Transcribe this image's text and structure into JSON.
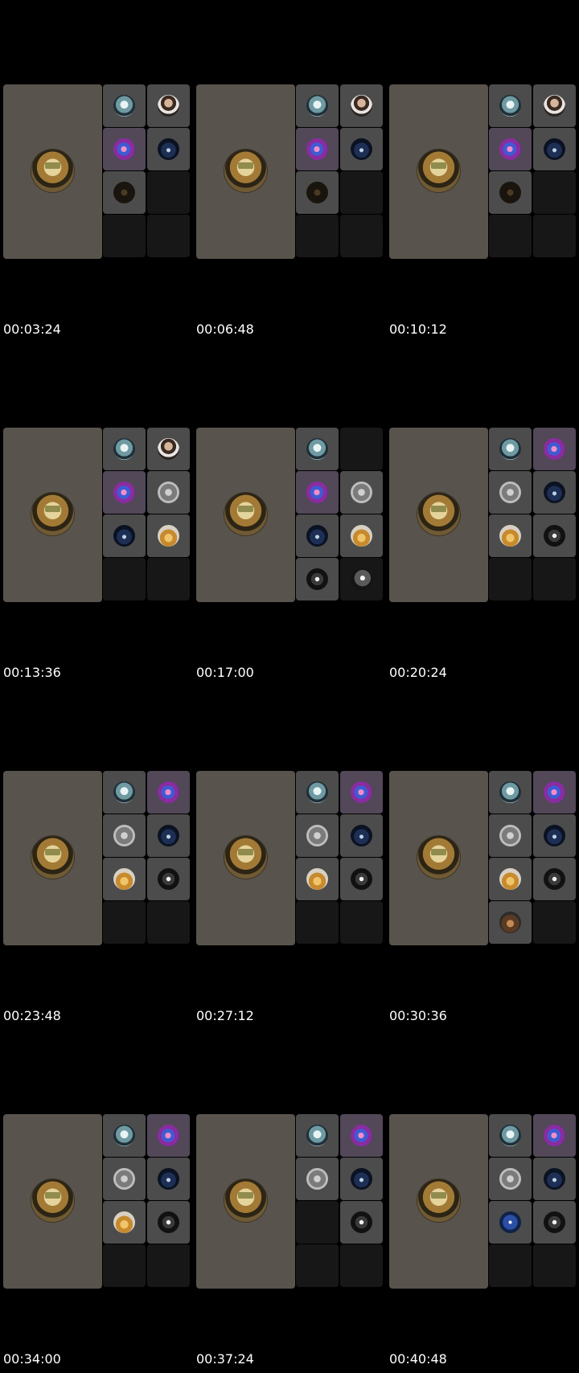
{
  "frames": [
    {
      "timestamp": "00:03:24",
      "cells": [
        {
          "kind": "white",
          "state": "on"
        },
        {
          "kind": "man",
          "state": "on"
        },
        {
          "kind": "anime",
          "state": "tint"
        },
        {
          "kind": "hood",
          "state": "on"
        },
        {
          "kind": "dark",
          "state": "on"
        },
        {
          "kind": "",
          "state": "off"
        },
        {
          "kind": "",
          "state": "off"
        },
        {
          "kind": "",
          "state": "off"
        }
      ]
    },
    {
      "timestamp": "00:06:48",
      "cells": [
        {
          "kind": "white",
          "state": "on"
        },
        {
          "kind": "man",
          "state": "on"
        },
        {
          "kind": "anime",
          "state": "tint"
        },
        {
          "kind": "hood",
          "state": "on"
        },
        {
          "kind": "dark",
          "state": "on"
        },
        {
          "kind": "",
          "state": "off"
        },
        {
          "kind": "",
          "state": "off"
        },
        {
          "kind": "",
          "state": "off"
        }
      ]
    },
    {
      "timestamp": "00:10:12",
      "cells": [
        {
          "kind": "white",
          "state": "on"
        },
        {
          "kind": "man",
          "state": "on"
        },
        {
          "kind": "anime",
          "state": "tint"
        },
        {
          "kind": "hood",
          "state": "on"
        },
        {
          "kind": "dark",
          "state": "on"
        },
        {
          "kind": "",
          "state": "off"
        },
        {
          "kind": "",
          "state": "off"
        },
        {
          "kind": "",
          "state": "off"
        }
      ]
    },
    {
      "timestamp": "00:13:36",
      "cells": [
        {
          "kind": "white",
          "state": "on"
        },
        {
          "kind": "man",
          "state": "on"
        },
        {
          "kind": "anime",
          "state": "tint"
        },
        {
          "kind": "statue",
          "state": "on"
        },
        {
          "kind": "hood",
          "state": "on"
        },
        {
          "kind": "gold",
          "state": "on"
        },
        {
          "kind": "",
          "state": "off"
        },
        {
          "kind": "",
          "state": "off"
        }
      ]
    },
    {
      "timestamp": "00:17:00",
      "cells": [
        {
          "kind": "white",
          "state": "on"
        },
        {
          "kind": "",
          "state": "off"
        },
        {
          "kind": "anime",
          "state": "tint"
        },
        {
          "kind": "statue",
          "state": "on"
        },
        {
          "kind": "hood",
          "state": "on"
        },
        {
          "kind": "gold",
          "state": "on"
        },
        {
          "kind": "skull",
          "state": "on"
        },
        {
          "kind": "bw",
          "state": "off"
        }
      ]
    },
    {
      "timestamp": "00:20:24",
      "cells": [
        {
          "kind": "white",
          "state": "on"
        },
        {
          "kind": "anime",
          "state": "tint"
        },
        {
          "kind": "statue",
          "state": "on"
        },
        {
          "kind": "hood",
          "state": "on"
        },
        {
          "kind": "gold",
          "state": "on"
        },
        {
          "kind": "skull",
          "state": "on"
        },
        {
          "kind": "",
          "state": "off"
        },
        {
          "kind": "",
          "state": "off"
        }
      ]
    },
    {
      "timestamp": "00:23:48",
      "cells": [
        {
          "kind": "white",
          "state": "on"
        },
        {
          "kind": "anime",
          "state": "tint"
        },
        {
          "kind": "statue",
          "state": "on"
        },
        {
          "kind": "hood",
          "state": "on"
        },
        {
          "kind": "gold",
          "state": "on"
        },
        {
          "kind": "skull",
          "state": "on"
        },
        {
          "kind": "",
          "state": "off"
        },
        {
          "kind": "",
          "state": "off"
        }
      ]
    },
    {
      "timestamp": "00:27:12",
      "cells": [
        {
          "kind": "white",
          "state": "on"
        },
        {
          "kind": "anime",
          "state": "tint"
        },
        {
          "kind": "statue",
          "state": "on"
        },
        {
          "kind": "hood",
          "state": "on"
        },
        {
          "kind": "gold",
          "state": "on"
        },
        {
          "kind": "skull",
          "state": "on"
        },
        {
          "kind": "",
          "state": "off"
        },
        {
          "kind": "",
          "state": "off"
        }
      ]
    },
    {
      "timestamp": "00:30:36",
      "cells": [
        {
          "kind": "white",
          "state": "on"
        },
        {
          "kind": "anime",
          "state": "tint"
        },
        {
          "kind": "statue",
          "state": "on"
        },
        {
          "kind": "hood",
          "state": "on"
        },
        {
          "kind": "gold",
          "state": "on"
        },
        {
          "kind": "skull",
          "state": "on"
        },
        {
          "kind": "dog",
          "state": "on"
        },
        {
          "kind": "",
          "state": "off"
        }
      ]
    },
    {
      "timestamp": "00:34:00",
      "cells": [
        {
          "kind": "white",
          "state": "on"
        },
        {
          "kind": "anime",
          "state": "tint"
        },
        {
          "kind": "statue",
          "state": "on"
        },
        {
          "kind": "hood",
          "state": "on"
        },
        {
          "kind": "gold",
          "state": "on"
        },
        {
          "kind": "skull",
          "state": "on"
        },
        {
          "kind": "",
          "state": "off"
        },
        {
          "kind": "",
          "state": "off"
        }
      ]
    },
    {
      "timestamp": "00:37:24",
      "cells": [
        {
          "kind": "white",
          "state": "on"
        },
        {
          "kind": "anime",
          "state": "tint"
        },
        {
          "kind": "statue",
          "state": "on"
        },
        {
          "kind": "hood",
          "state": "on"
        },
        {
          "kind": "",
          "state": "off"
        },
        {
          "kind": "skull",
          "state": "on"
        },
        {
          "kind": "",
          "state": "off"
        },
        {
          "kind": "",
          "state": "off"
        }
      ]
    },
    {
      "timestamp": "00:40:48",
      "cells": [
        {
          "kind": "white",
          "state": "on"
        },
        {
          "kind": "anime",
          "state": "tint"
        },
        {
          "kind": "statue",
          "state": "on"
        },
        {
          "kind": "hood",
          "state": "on"
        },
        {
          "kind": "logo",
          "state": "on"
        },
        {
          "kind": "skull",
          "state": "on"
        },
        {
          "kind": "",
          "state": "off"
        },
        {
          "kind": "",
          "state": "off"
        }
      ]
    }
  ],
  "colors": {
    "background": "#000000",
    "main_tile": "#59534d",
    "tile_on": "#4c4c4c",
    "tile_off": "#171717",
    "tile_tint": "#524858",
    "timestamp_text": "#ffffff"
  }
}
